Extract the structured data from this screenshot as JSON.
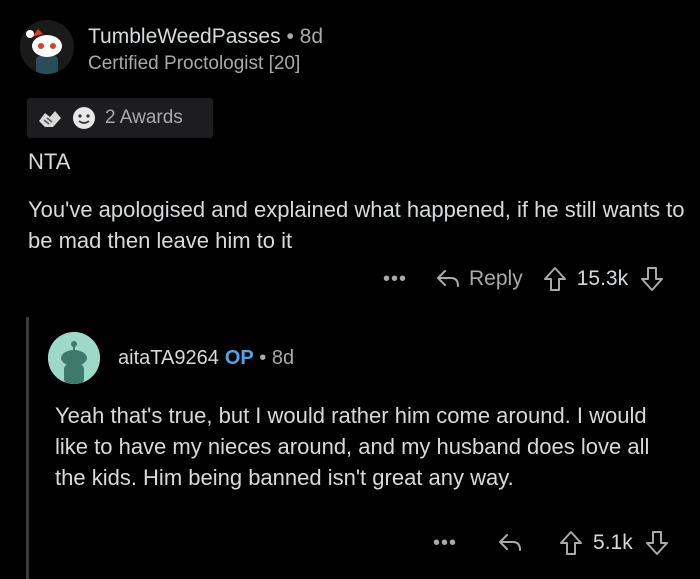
{
  "comment": {
    "username": "TumbleWeedPasses",
    "separator": "•",
    "age": "8d",
    "flair": "Certified Proctologist [20]",
    "awards_label": "2 Awards",
    "paragraphs": [
      "NTA",
      "You've apologised and explained what happened, if he still wants to be mad then leave him to it"
    ],
    "more": "•••",
    "reply_label": "Reply",
    "score": "15.3k"
  },
  "reply": {
    "username": "aitaTA9264",
    "op_badge": "OP",
    "separator": "•",
    "age": "8d",
    "body": "Yeah that's true, but I would rather him come around. I would like to have my nieces around, and my husband does love all the kids. Him being banned isn't great any way.",
    "more": "•••",
    "score": "5.1k"
  },
  "colors": {
    "background": "#000000",
    "text": "#d7dadc",
    "muted": "#a8aaab",
    "op": "#4fa3e6",
    "award_bg": "#1d1d1f",
    "thread_line": "#3a3a3c"
  },
  "icons": [
    "snoo-avatar-icon",
    "handshake-award-icon",
    "wholesome-award-icon",
    "reply-arrow-icon",
    "upvote-arrow-icon",
    "downvote-arrow-icon"
  ]
}
